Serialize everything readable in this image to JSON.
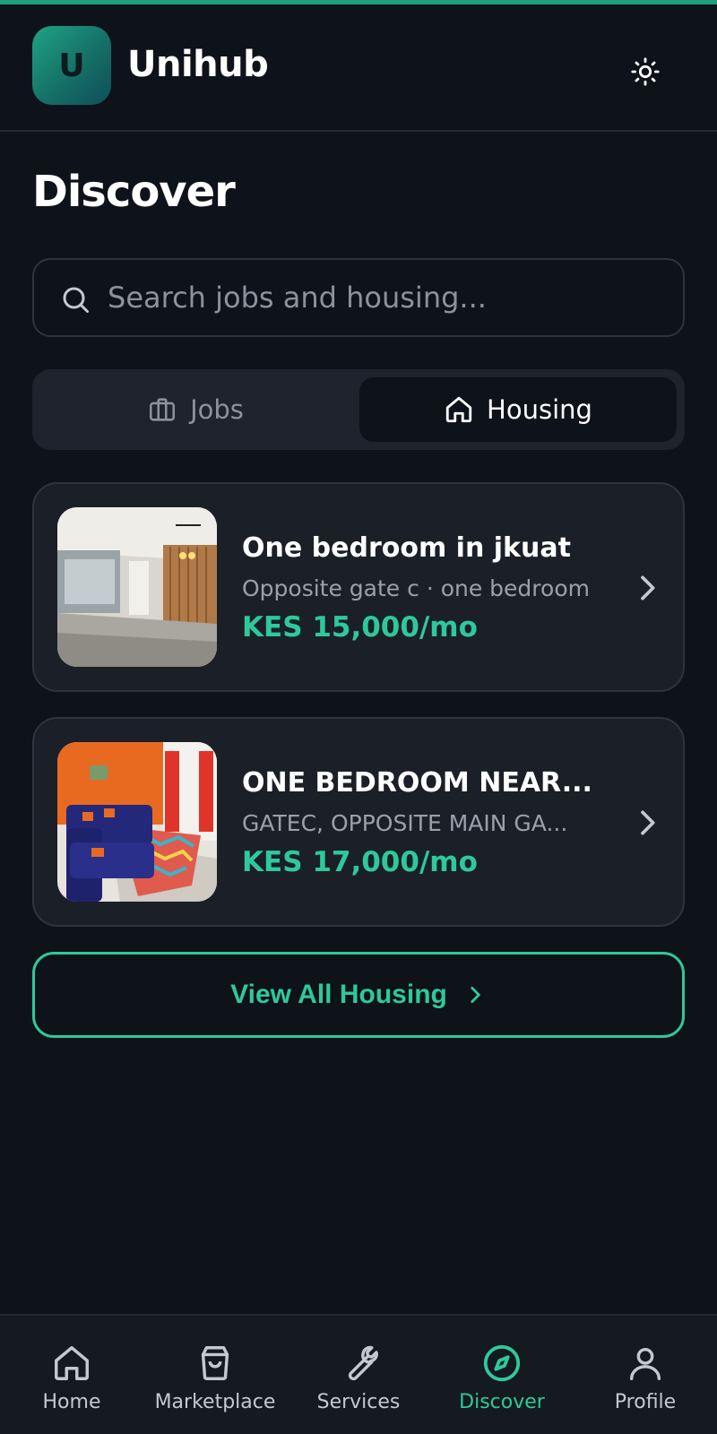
{
  "app": {
    "logo_letter": "U",
    "name": "Unihub"
  },
  "header": {
    "theme_icon": "sun-icon"
  },
  "page": {
    "title": "Discover"
  },
  "search": {
    "placeholder": "Search jobs and housing...",
    "value": ""
  },
  "tabs": [
    {
      "label": "Jobs",
      "icon": "briefcase-icon",
      "selected": false
    },
    {
      "label": "Housing",
      "icon": "home-icon",
      "selected": true
    }
  ],
  "listings": [
    {
      "title": "One bedroom in jkuat",
      "subtitle": "Opposite gate c · one bedroom",
      "price": "KES 15,000/mo"
    },
    {
      "title": "ONE BEDROOM NEAR...",
      "subtitle": "GATEC, OPPOSITE MAIN GA...",
      "price": "KES 17,000/mo"
    }
  ],
  "view_all": {
    "label": "View All Housing"
  },
  "nav": [
    {
      "label": "Home",
      "icon": "home-icon",
      "active": false
    },
    {
      "label": "Marketplace",
      "icon": "shopping-bag-icon",
      "active": false
    },
    {
      "label": "Services",
      "icon": "wrench-icon",
      "active": false
    },
    {
      "label": "Discover",
      "icon": "compass-icon",
      "active": true
    },
    {
      "label": "Profile",
      "icon": "user-icon",
      "active": false
    }
  ],
  "colors": {
    "accent": "#2ec99a",
    "background": "#0e121a",
    "card": "#1b1f28"
  }
}
